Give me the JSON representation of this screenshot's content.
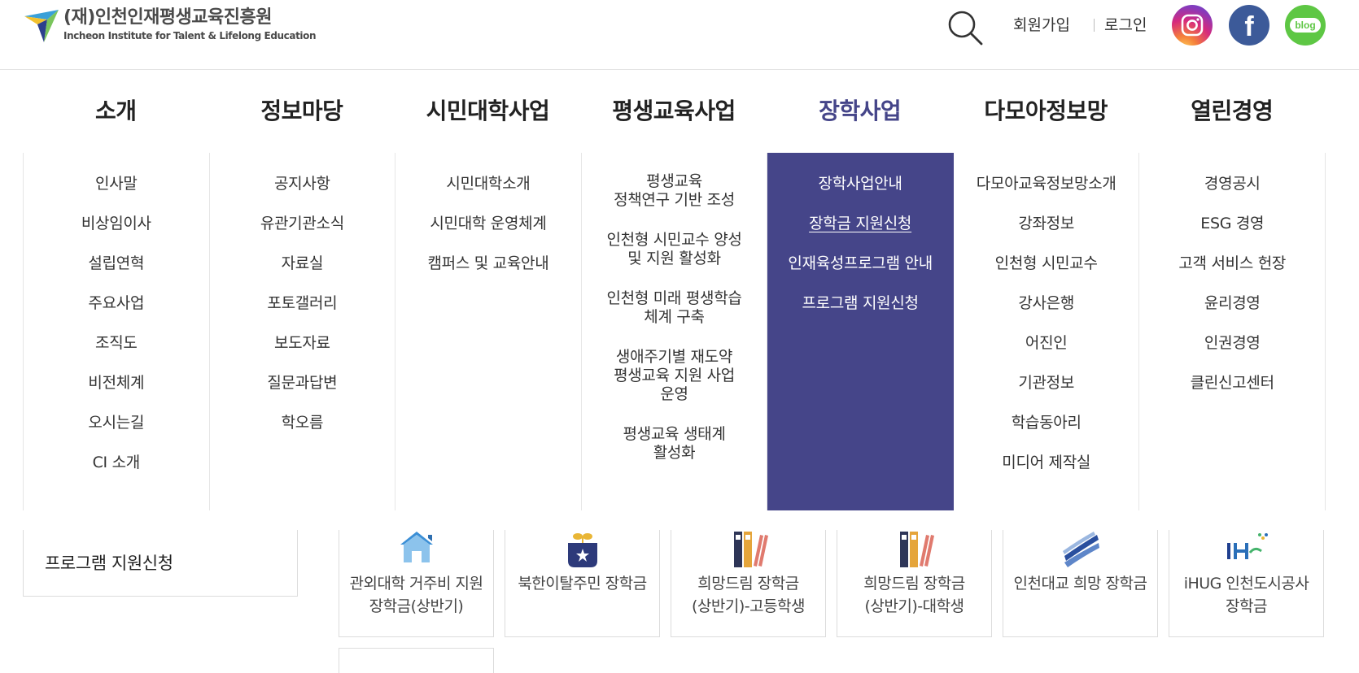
{
  "header": {
    "logo": {
      "ko": "(재)인천인재평생교육진흥원",
      "en": "Incheon Institute for Talent & Lifelong Education"
    },
    "utility": {
      "signup": "회원가입",
      "login": "로그인"
    },
    "sns": {
      "blog_label": "blog",
      "facebook_glyph": "f"
    },
    "colors": {
      "accent": "#454589",
      "instagram": "#d62a7d",
      "facebook": "#3c5a99",
      "blog": "#5ec744"
    }
  },
  "gnb": [
    {
      "label": "소개"
    },
    {
      "label": "정보마당"
    },
    {
      "label": "시민대학사업"
    },
    {
      "label": "평생교육사업"
    },
    {
      "label": "장학사업"
    },
    {
      "label": "다모아정보망"
    },
    {
      "label": "열린경영"
    }
  ],
  "mega": [
    [
      "인사말",
      "비상임이사",
      "설립연혁",
      "주요사업",
      "조직도",
      "비전체계",
      "오시는길",
      "CI 소개"
    ],
    [
      "공지사항",
      "유관기관소식",
      "자료실",
      "포토갤러리",
      "보도자료",
      "질문과답변",
      "학오름"
    ],
    [
      "시민대학소개",
      "시민대학 운영체계",
      "캠퍼스 및 교육안내"
    ],
    [
      "평생교육\n정책연구 기반 조성",
      "인천형 시민교수 양성\n및 지원 활성화",
      "인천형 미래 평생학습\n체계 구축",
      "생애주기별 재도약\n평생교육 지원 사업\n운영",
      "평생교육 생태계\n활성화"
    ],
    [
      "장학사업안내",
      "장학금 지원신청",
      "인재육성프로그램 안내",
      "프로그램 지원신청"
    ],
    [
      "다모아교육정보망소개",
      "강좌정보",
      "인천형 시민교수",
      "강사은행",
      "어진인",
      "기관정보",
      "학습동아리",
      "미디어 제작실"
    ],
    [
      "경영공시",
      "ESG 경영",
      "고객 서비스 헌장",
      "윤리경영",
      "인권경영",
      "클린신고센터"
    ]
  ],
  "lnb": {
    "label": "프로그램 지원신청"
  },
  "cards": [
    {
      "label": "관외대학 거주비 지원\n장학금(상반기)",
      "icon": "house-icon"
    },
    {
      "label": "북한이탈주민 장학금",
      "icon": "plant-pot-icon"
    },
    {
      "label": "희망드림 장학금\n(상반기)-고등학생",
      "icon": "binders-icon"
    },
    {
      "label": "희망드림 장학금\n(상반기)-대학생",
      "icon": "binders-icon"
    },
    {
      "label": "인천대교 희망 장학금",
      "icon": "bridge-logo-icon"
    },
    {
      "label": "iHUG 인천도시공사\n장학금",
      "icon": "ihug-logo-icon"
    }
  ]
}
